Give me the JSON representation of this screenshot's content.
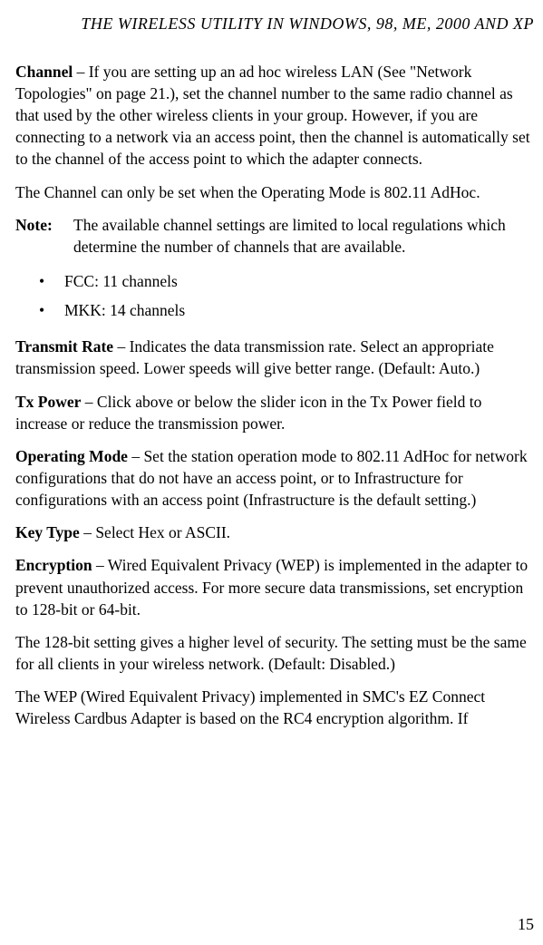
{
  "running_header": "THE WIRELESS UTILITY IN WINDOWS, 98, ME, 2000 AND XP",
  "channel": {
    "label": "Channel",
    "text": " – If you are setting up an ad hoc wireless LAN (See \"Network Topologies\" on page 21.), set the channel number to the same radio channel as that used by the other wireless clients in your group. However, if you are connecting to a network via an access point, then the channel is automatically set to the channel of the access point to which the adapter connects."
  },
  "channel_note": "The Channel can only be set when the Operating Mode is 802.11 AdHoc.",
  "note": {
    "label": "Note:",
    "text": "The available channel settings are limited to local regulations which determine the number of channels that are available."
  },
  "bullets": [
    "FCC: 11 channels",
    "MKK: 14 channels"
  ],
  "transmit_rate": {
    "label": "Transmit Rate",
    "text": " – Indicates the data transmission rate. Select an appropriate transmission speed. Lower speeds will give better range. (Default: Auto.)"
  },
  "tx_power": {
    "label": "Tx Power",
    "text": " – Click above or below the slider icon in the Tx Power field to increase or reduce the transmission power."
  },
  "operating_mode": {
    "label": "Operating Mode",
    "text": " – Set the station operation mode to 802.11 AdHoc for network configurations that do not have an access point, or to Infrastructure for configurations with an access point (Infrastructure is the default setting.)"
  },
  "key_type": {
    "label": "Key Type",
    "text": " – Select Hex or ASCII."
  },
  "encryption": {
    "label": "Encryption",
    "text": " – Wired Equivalent Privacy (WEP) is implemented in the adapter to prevent unauthorized access. For more secure data transmissions, set encryption to 128-bit or 64-bit."
  },
  "encryption_p2": "The 128-bit setting gives a higher level of security. The setting must be the same for all clients in your wireless network. (Default: Disabled.)",
  "encryption_p3": "The WEP (Wired Equivalent Privacy) implemented in SMC's EZ Connect Wireless Cardbus Adapter is based on the RC4 encryption algorithm. If",
  "page_number": "15"
}
